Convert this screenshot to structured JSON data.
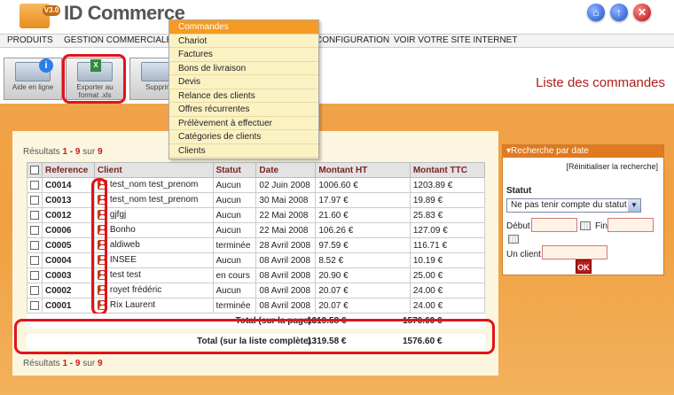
{
  "header": {
    "logo_badge": "V3.0",
    "logo_text": "ID Commerce",
    "icons": [
      "home-icon",
      "up-icon",
      "close-icon"
    ]
  },
  "menu": [
    "PRODUITS",
    "GESTION COMMERCIALE",
    "CONFIGURATION",
    "VOIR VOTRE SITE INTERNET"
  ],
  "dropdown": [
    "Commandes",
    "Chariot",
    "Factures",
    "Bons de livraison",
    "Devis",
    "Relance des clients",
    "Offres récurrentes",
    "Prélèvement à effectuer",
    "Catégories de clients",
    "Clients"
  ],
  "toolbar": {
    "help_label": "Aide en ligne",
    "export_label": "Exporter au format .xls",
    "delete_label": "Supprim"
  },
  "page_title": "Liste des commandes",
  "results": {
    "prefix": "Résultats ",
    "range": "1 - 9",
    "sep": " sur ",
    "total": "9"
  },
  "table": {
    "headers": [
      "Reference",
      "Client",
      "Statut",
      "Date",
      "Montant HT",
      "Montant TTC"
    ],
    "rows": [
      [
        "C0014",
        "test_nom test_prenom",
        "Aucun",
        "02 Juin 2008",
        "1006.60 €",
        "1203.89 €"
      ],
      [
        "C0013",
        "test_nom test_prenom",
        "Aucun",
        "30 Mai 2008",
        "17.97 €",
        "19.89 €"
      ],
      [
        "C0012",
        "gjfgj",
        "Aucun",
        "22 Mai 2008",
        "21.60 €",
        "25.83 €"
      ],
      [
        "C0006",
        "Bonho",
        "Aucun",
        "22 Mai 2008",
        "106.26 €",
        "127.09 €"
      ],
      [
        "C0005",
        "aldiweb",
        "terminée",
        "28 Avril 2008",
        "97.59 €",
        "116.71 €"
      ],
      [
        "C0004",
        "INSEE",
        "Aucun",
        "08 Avril 2008",
        "8.52 €",
        "10.19 €"
      ],
      [
        "C0003",
        "test test",
        "en cours",
        "08 Avril 2008",
        "20.90 €",
        "25.00 €"
      ],
      [
        "C0002",
        "royet frédéric",
        "Aucun",
        "08 Avril 2008",
        "20.07 €",
        "24.00 €"
      ],
      [
        "C0001",
        "Rix Laurent",
        "terminée",
        "08 Avril 2008",
        "20.07 €",
        "24.00 €"
      ]
    ]
  },
  "totals": {
    "page_label": "Total (sur la page) :",
    "page_ht": "1319.58 €",
    "page_ttc": "1576.60 €",
    "all_label": "Total (sur la liste complète) :",
    "all_ht": "1319.58 €",
    "all_ttc": "1576.60 €"
  },
  "search": {
    "title": "Recherche par date",
    "reset": "[Réinitialiser la recherche]",
    "statut_label": "Statut",
    "statut_value": "Ne pas tenir compte du statut",
    "debut_label": "Début",
    "fin_label": "Fin",
    "client_label": "Un client",
    "ok_label": "OK"
  }
}
